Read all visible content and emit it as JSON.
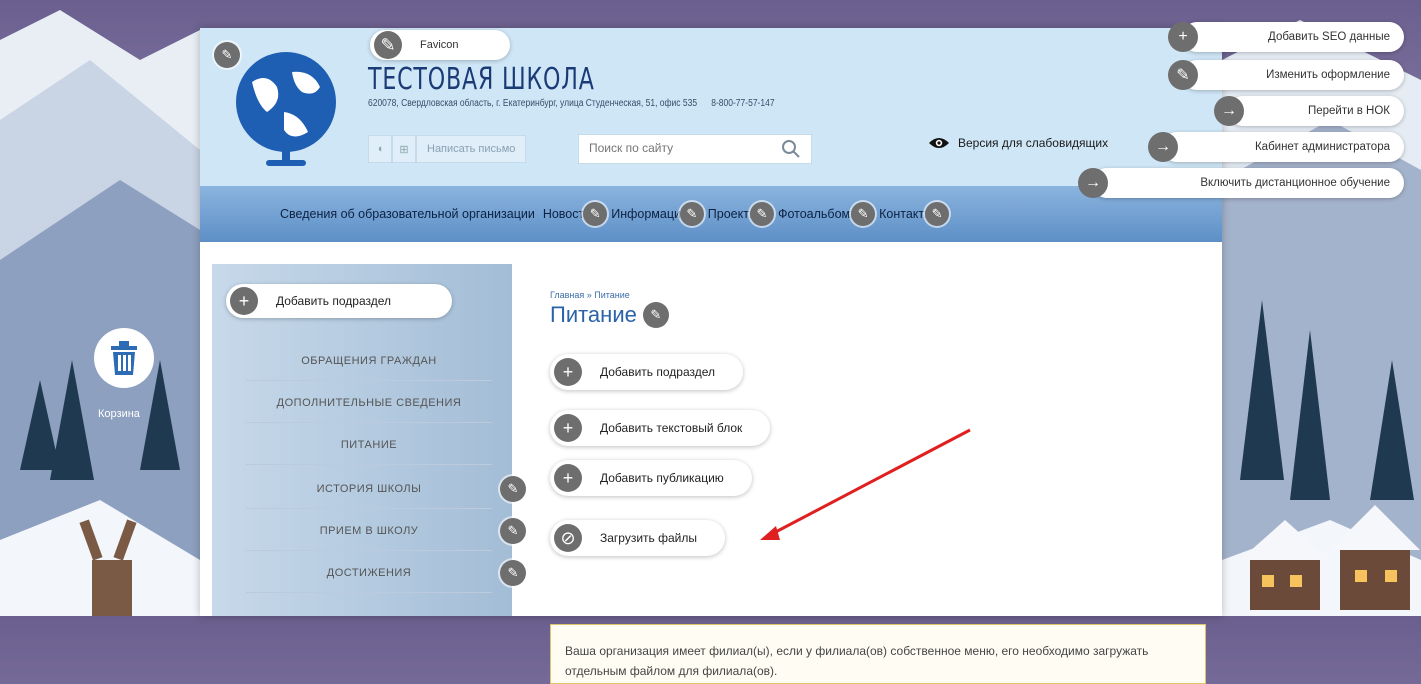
{
  "header": {
    "favicon_label": "Favicon",
    "site_title": "ТЕСТОВАЯ ШКОЛА",
    "address": "620078, Свердловская область, г. Екатеринбург, улица Студенческая, 51, офис 535",
    "phone": "8-800-77-57-147",
    "write_letter": "Написать письмо",
    "search_placeholder": "Поиск по сайту",
    "vision_label": "Версия для слабовидящих"
  },
  "nav": {
    "items": [
      "Сведения об образовательной организации",
      "Новости",
      "Информация",
      "Проекты",
      "Фотоальбомы",
      "Контакты"
    ]
  },
  "admin": {
    "seo": "Добавить SEO данные",
    "design": "Изменить оформление",
    "nok": "Перейти в НОК",
    "cabinet": "Кабинет администратора",
    "distance": "Включить дистанционное обучение"
  },
  "trash": {
    "label": "Корзина"
  },
  "sidebar": {
    "add_label": "Добавить подраздел",
    "items": [
      "ОБРАЩЕНИЯ ГРАЖДАН",
      "ДОПОЛНИТЕЛЬНЫЕ СВЕДЕНИЯ",
      "ПИТАНИЕ",
      "ИСТОРИЯ ШКОЛЫ",
      "ПРИЕМ В ШКОЛУ",
      "ДОСТИЖЕНИЯ"
    ]
  },
  "content": {
    "breadcrumb": "Главная » Питание",
    "title": "Питание",
    "add_subsection": "Добавить подраздел",
    "add_text_block": "Добавить текстовый блок",
    "add_publication": "Добавить публикацию",
    "upload_files": "Загрузить файлы",
    "notice": "Ваша организация имеет филиал(ы), если у филиала(ов) собственное меню, его необходимо загружать отдельным файлом для филиала(ов)."
  },
  "colors": {
    "accent": "#2b63a8",
    "nav_gradient_top": "#8bb4df",
    "admin_circle": "#6e6e6e",
    "arrow": "#e02020"
  }
}
